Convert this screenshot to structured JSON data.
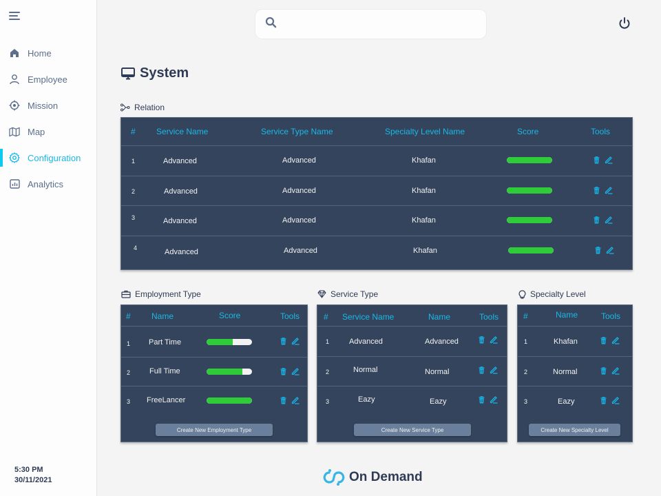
{
  "sidebar": {
    "items": [
      {
        "label": "Home",
        "icon": "home-icon",
        "active": false
      },
      {
        "label": "Employee",
        "icon": "user-icon",
        "active": false
      },
      {
        "label": "Mission",
        "icon": "crosshair-icon",
        "active": false
      },
      {
        "label": "Map",
        "icon": "map-icon",
        "active": false
      },
      {
        "label": "Configuration",
        "icon": "gear-icon",
        "active": true
      },
      {
        "label": "Analytics",
        "icon": "chart-icon",
        "active": false
      }
    ],
    "time": "5:30 PM",
    "date": "30/11/2021"
  },
  "search": {
    "placeholder": "",
    "value": ""
  },
  "page": {
    "title": "System"
  },
  "relation": {
    "label": "Relation",
    "headers": [
      "#",
      "Service Name",
      "Service Type Name",
      "Specialty Level Name",
      "Score",
      "Tools"
    ],
    "rows": [
      {
        "index": "1",
        "service_name": "Advanced",
        "service_type_name": "Advanced",
        "specialty_level_name": "Khafan",
        "score_percent": 100
      },
      {
        "index": "2",
        "service_name": "Advanced",
        "service_type_name": "Advanced",
        "specialty_level_name": "Khafan",
        "score_percent": 100
      },
      {
        "index": "3",
        "service_name": "Advanced",
        "service_type_name": "Advanced",
        "specialty_level_name": "Khafan",
        "score_percent": 100
      },
      {
        "index": "4",
        "service_name": "Advanced",
        "service_type_name": "Advanced",
        "specialty_level_name": "Khafan",
        "score_percent": 100
      }
    ]
  },
  "employment_type": {
    "label": "Employment Type",
    "headers": [
      "#",
      "Name",
      "Score",
      "Tools"
    ],
    "rows": [
      {
        "index": "1",
        "name": "Part Time",
        "score_percent": 57
      },
      {
        "index": "2",
        "name": "Full Time",
        "score_percent": 79
      },
      {
        "index": "3",
        "name": "FreeLancer",
        "score_percent": 100
      }
    ],
    "create_label": "Create  New Employment Type"
  },
  "service_type": {
    "label": "Service Type",
    "headers": [
      "#",
      "Service Name",
      "Name",
      "Tools"
    ],
    "rows": [
      {
        "index": "1",
        "service_name": "Advanced",
        "name": "Advanced"
      },
      {
        "index": "2",
        "service_name": "Normal",
        "name": "Normal"
      },
      {
        "index": "3",
        "service_name": "Eazy",
        "name": "Eazy"
      }
    ],
    "create_label": "Create  New Service Type"
  },
  "specialty_level": {
    "label": "Specialty Level",
    "headers": [
      "#",
      "Name",
      "Tools"
    ],
    "rows": [
      {
        "index": "1",
        "name": "Khafan"
      },
      {
        "index": "2",
        "name": "Normal"
      },
      {
        "index": "3",
        "name": "Eazy"
      }
    ],
    "create_label": "Create New Specialty Level"
  },
  "brand": {
    "name": "On Demand"
  },
  "colors": {
    "accent": "#1ab8e6",
    "panel": "#34445c",
    "score_fill": "#2ecc38",
    "score_track": "#f2f2f2"
  }
}
